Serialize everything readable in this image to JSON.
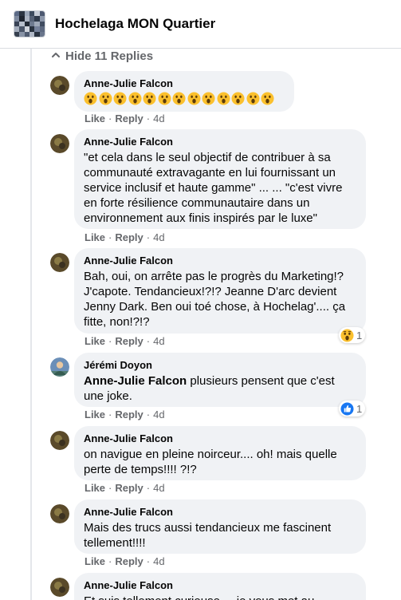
{
  "header": {
    "group_name": "Hochelaga MON Quartier"
  },
  "thread": {
    "toggle_label": "Hide 11 Replies"
  },
  "actions_labels": {
    "like": "Like",
    "reply": "Reply",
    "sep": "·"
  },
  "comments": [
    {
      "author": "Anne-Julie Falcon",
      "emoji_count": 13,
      "time": "4d"
    },
    {
      "author": "Anne-Julie Falcon",
      "text": "\"et cela dans le seul objectif de contribuer à sa communauté extravagante en lui fournissant un service inclusif et haute gamme\" ... ... \"c'est vivre en forte résilience communautaire dans un environnement aux finis inspirés par le luxe\"",
      "time": "4d"
    },
    {
      "author": "Anne-Julie Falcon",
      "text": "Bah, oui, on arrête pas le progrès du Marketing!? J'capote. Tendancieux!?!? Jeanne D'arc devient Jenny Dark. Ben oui toé chose, à Hochelag'.... ça fitte, non!?!?",
      "time": "4d",
      "reaction": {
        "type": "wow",
        "count": "1"
      }
    },
    {
      "author": "Jérémi Doyon",
      "mention": "Anne-Julie Falcon",
      "text": " plusieurs pensent que c'est une joke.",
      "time": "4d",
      "reaction": {
        "type": "like",
        "count": "1"
      }
    },
    {
      "author": "Anne-Julie Falcon",
      "text": "on navigue en pleine noirceur.... oh! mais quelle perte de temps!!!! ?!?",
      "time": "4d"
    },
    {
      "author": "Anne-Julie Falcon",
      "text": "Mais des trucs aussi tendancieux me fascinent tellement!!!!",
      "time": "4d"
    },
    {
      "author": "Anne-Julie Falcon",
      "text": "Et suis tellement curieuse.... je vous met au"
    }
  ],
  "colors": {
    "bubble": "#f0f2f5",
    "secondary_text": "#65676b",
    "like_blue": "#1877f2",
    "wow_yellow": "#fbc02d"
  }
}
